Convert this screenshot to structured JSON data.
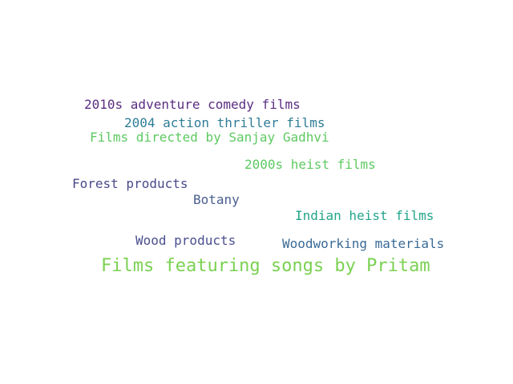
{
  "word_cloud": {
    "words": [
      {
        "text": "2010s adventure comedy films",
        "color": "#5b2d82"
      },
      {
        "text": "2004 action thriller films",
        "color": "#2f7d96"
      },
      {
        "text": "Films directed by Sanjay Gadhvi",
        "color": "#5ec962"
      },
      {
        "text": "2000s heist films",
        "color": "#5ec962"
      },
      {
        "text": "Forest products",
        "color": "#4a4a8a"
      },
      {
        "text": "Botany",
        "color": "#4a5e8f"
      },
      {
        "text": "Indian heist films",
        "color": "#22a58a"
      },
      {
        "text": "Wood products",
        "color": "#4a4f8f"
      },
      {
        "text": "Woodworking materials",
        "color": "#3a6a96"
      },
      {
        "text": "Films featuring songs by Pritam",
        "color": "#7ad151"
      }
    ]
  }
}
